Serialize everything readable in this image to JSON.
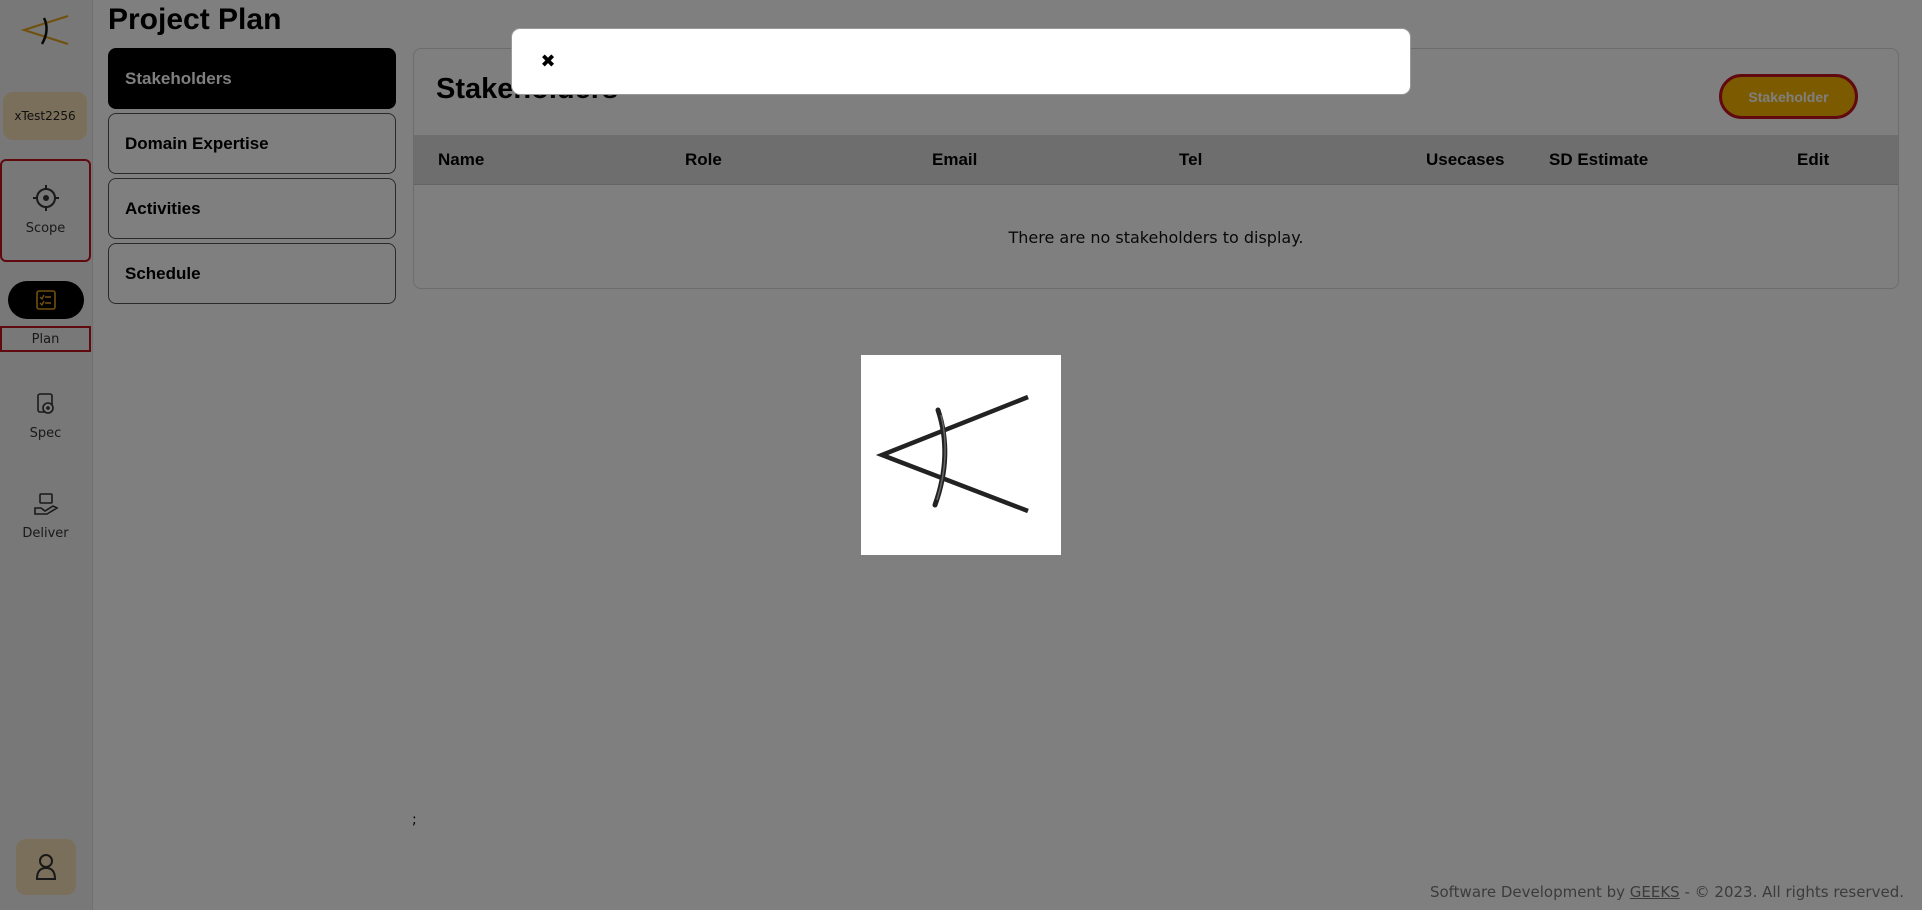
{
  "sidebar": {
    "user": "xTest2256",
    "nav": {
      "scope": "Scope",
      "plan": "Plan",
      "spec": "Spec",
      "deliver": "Deliver"
    },
    "colors": {
      "accent": "#f7b500",
      "highlight_border": "#c1121f",
      "chip": "#f5dfb4"
    }
  },
  "page": {
    "title": "Project Plan",
    "subnav": [
      "Stakeholders",
      "Domain Expertise",
      "Activities",
      "Schedule"
    ],
    "active_subnav": "Stakeholders"
  },
  "panel": {
    "title": "Stakeholders",
    "add_button": "Stakeholder",
    "columns": [
      "Name",
      "Role",
      "Email",
      "Tel",
      "Usecases",
      "SD Estimate",
      "Edit"
    ],
    "rows": [],
    "empty_message": "There are no stakeholders to display."
  },
  "misc": {
    "stray_text": ";"
  },
  "footer": {
    "prefix": "Software Development by ",
    "link": "GEEKS",
    "suffix": " - © 2023. All rights reserved."
  },
  "modal": {
    "close_glyph": "✖",
    "body": ""
  }
}
